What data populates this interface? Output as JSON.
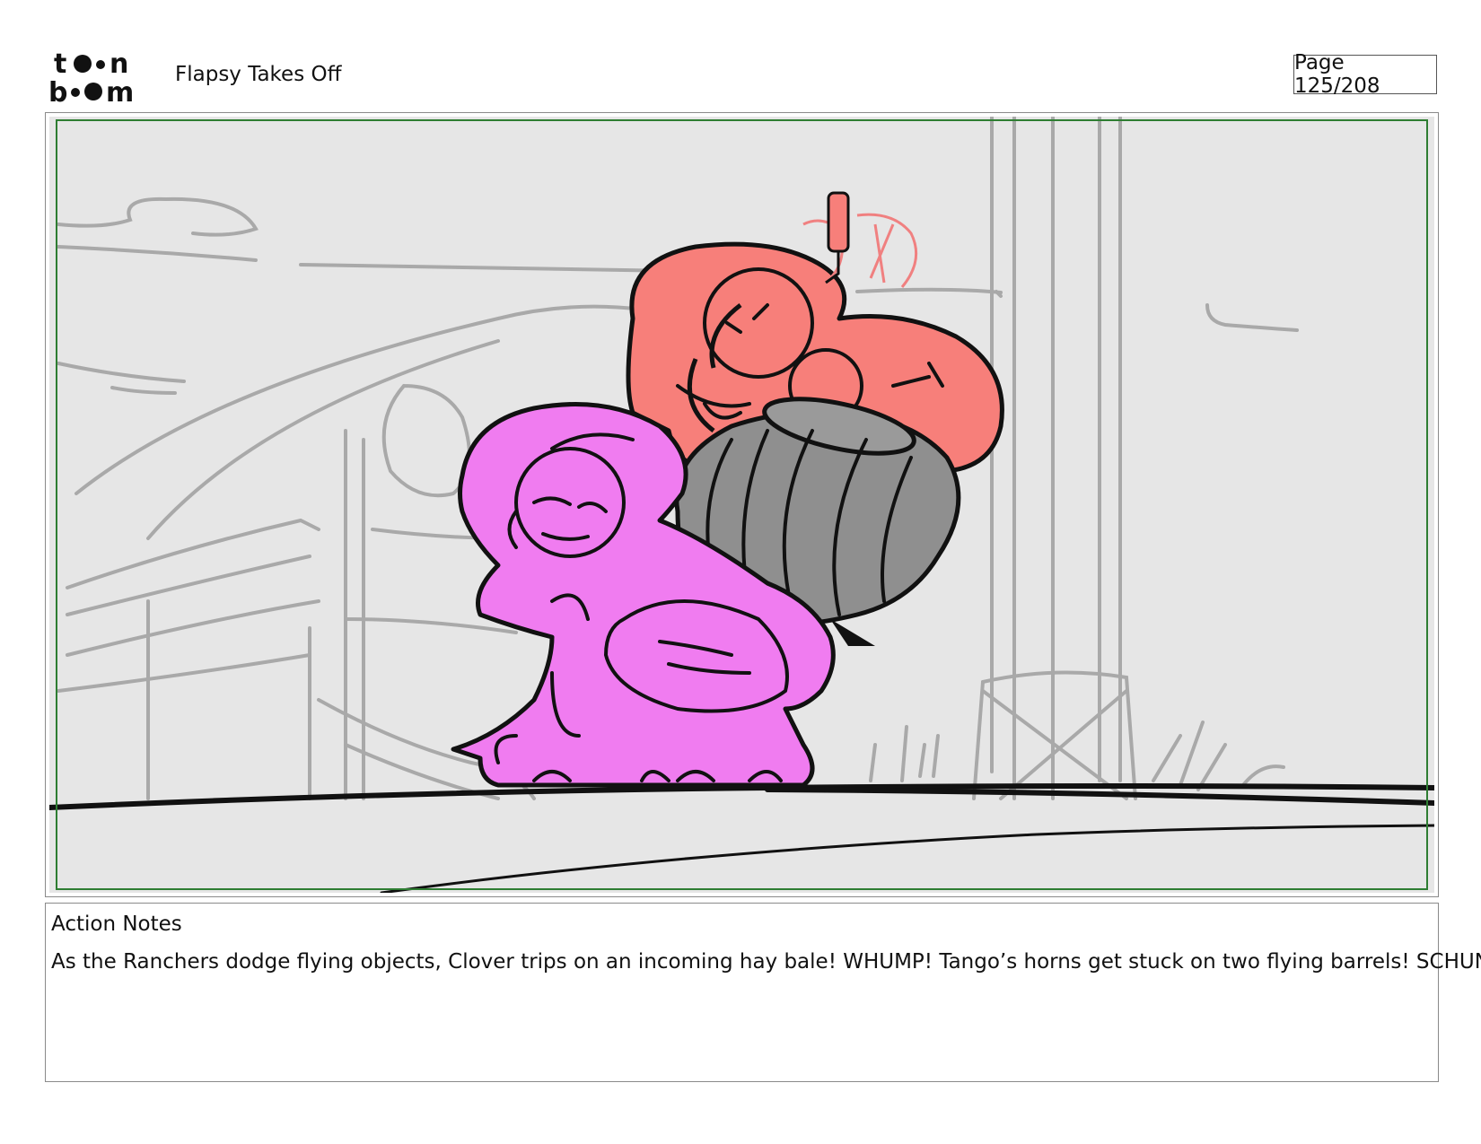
{
  "header": {
    "logo_name": "toon-boom-logo",
    "title": "Flapsy Takes Off",
    "page_label": "Page 125/208"
  },
  "panel": {
    "frame_color": "#2e7d32",
    "background": "#e6e6e6",
    "colors": {
      "background_sketch": "#a9a9a9",
      "character_pink": "#f07cf0",
      "character_red": "#f77f7a",
      "barrel": "#8f8f8f",
      "ink": "#111111"
    }
  },
  "notes": {
    "heading": "Action Notes",
    "text": "As the Ranchers dodge flying objects, Clover trips on an incoming hay bale! WHUMP! Tango’s horns get stuck on two flying barrels! SCHUNK!"
  }
}
